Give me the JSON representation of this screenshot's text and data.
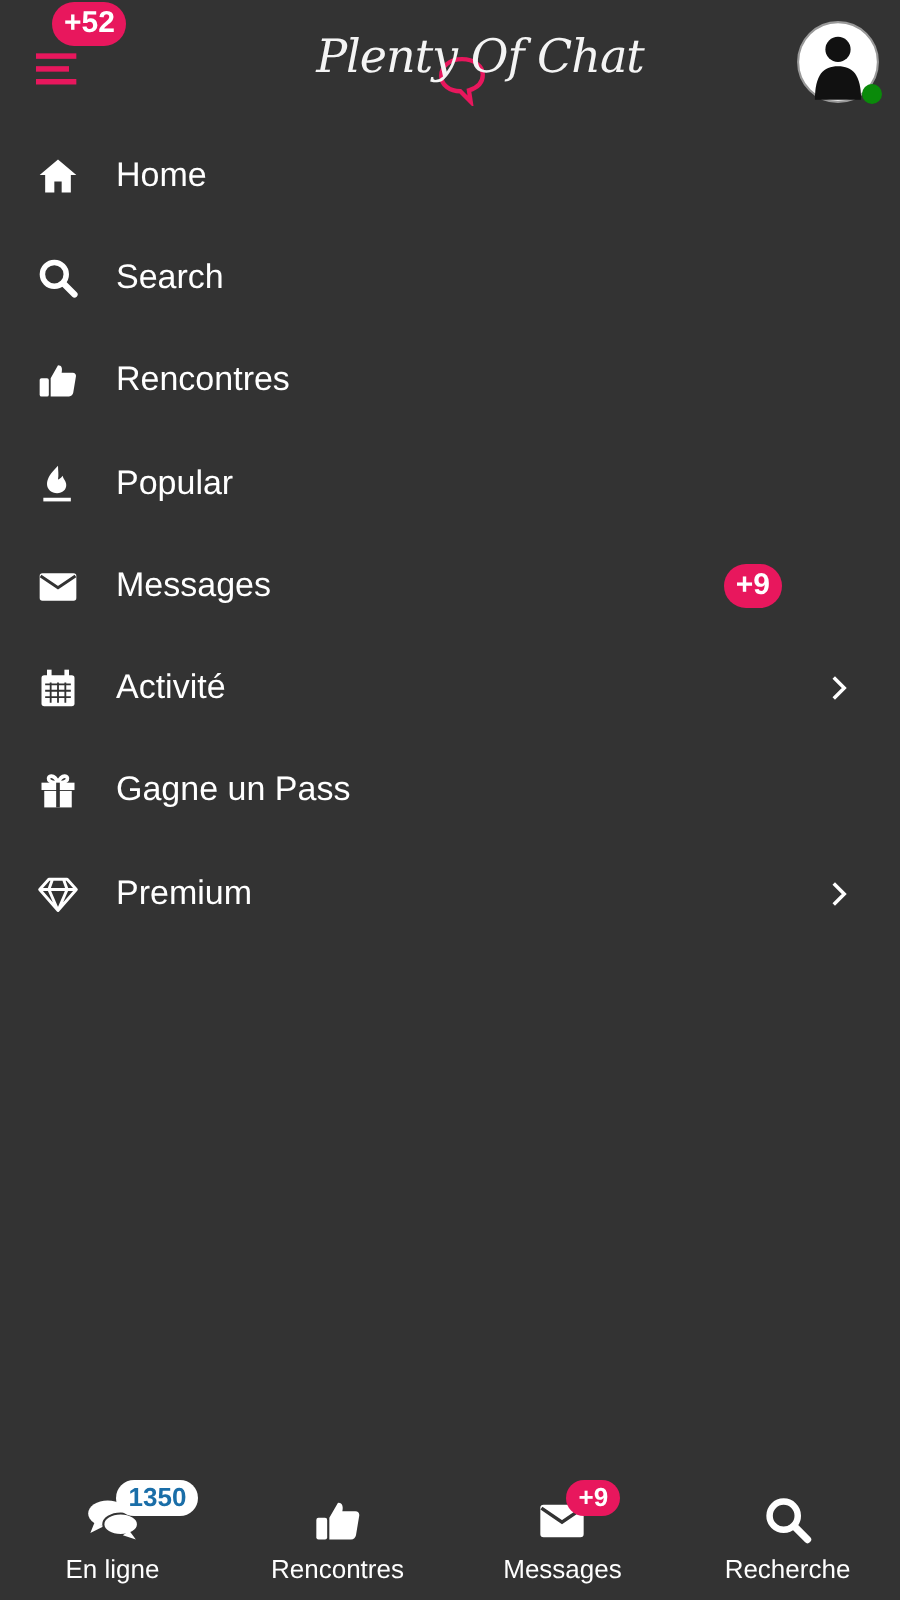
{
  "header": {
    "notification_count": "+52",
    "logo": "Plenty Of Chat",
    "online": true
  },
  "menu": [
    {
      "kind": "home",
      "label": "Home",
      "submenu": false
    },
    {
      "kind": "search",
      "label": "Search",
      "submenu": false
    },
    {
      "kind": "thumb",
      "label": "Rencontres",
      "submenu": false
    },
    {
      "kind": "fire",
      "label": "Popular",
      "submenu": false
    },
    {
      "kind": "mail",
      "label": "Messages",
      "badge": "+9",
      "submenu": false
    },
    {
      "kind": "calendar",
      "label": "Activité",
      "submenu": true
    },
    {
      "kind": "gift",
      "label": "Gagne un Pass",
      "submenu": false
    },
    {
      "kind": "diamond",
      "label": "Premium",
      "submenu": true
    }
  ],
  "bottom_nav": [
    {
      "kind": "chat",
      "label": "En ligne",
      "badge": {
        "text": "1350",
        "color": "#ffffff"
      }
    },
    {
      "kind": "thumb",
      "label": "Rencontres"
    },
    {
      "kind": "mail",
      "label": "Messages",
      "badge": {
        "text": "+9",
        "color": "#e8175d"
      }
    },
    {
      "kind": "search",
      "label": "Recherche"
    }
  ]
}
